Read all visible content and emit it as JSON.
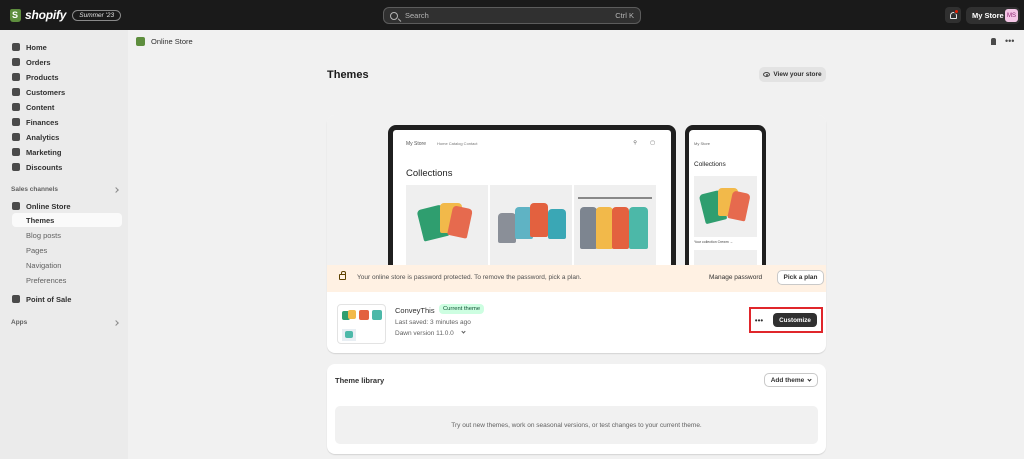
{
  "topbar": {
    "brand": "shopify",
    "edition": "Summer '23",
    "search_placeholder": "Search",
    "search_shortcut": "Ctrl K",
    "store_name": "My Store",
    "avatar_initials": "MS"
  },
  "sidebar": {
    "items": [
      {
        "label": "Home",
        "icon": "home-icon"
      },
      {
        "label": "Orders",
        "icon": "orders-icon"
      },
      {
        "label": "Products",
        "icon": "tag-icon"
      },
      {
        "label": "Customers",
        "icon": "person-icon"
      },
      {
        "label": "Content",
        "icon": "content-icon"
      },
      {
        "label": "Finances",
        "icon": "bank-icon"
      },
      {
        "label": "Analytics",
        "icon": "bar-chart-icon"
      },
      {
        "label": "Marketing",
        "icon": "target-icon"
      },
      {
        "label": "Discounts",
        "icon": "discount-icon"
      }
    ],
    "sales_channels_label": "Sales channels",
    "online_store": "Online Store",
    "online_store_subitems": [
      "Themes",
      "Blog posts",
      "Pages",
      "Navigation",
      "Preferences"
    ],
    "point_of_sale": "Point of Sale",
    "apps_label": "Apps"
  },
  "header": {
    "breadcrumb": "Online Store"
  },
  "main": {
    "title": "Themes",
    "view_store": "View your store",
    "preview": {
      "store_name": "My Store",
      "nav_links": "Home   Catalog   Contact",
      "collections_title": "Collections",
      "phone_caption": "Your collection Crewm →"
    },
    "banner": {
      "text": "Your online store is password protected. To remove the password, pick a plan.",
      "manage_password": "Manage password",
      "pick_plan": "Pick a plan"
    },
    "current_theme": {
      "name": "ConveyThis",
      "badge": "Current theme",
      "last_saved": "Last saved: 3 minutes ago",
      "version": "Dawn version 11.0.0",
      "more_label": "•••",
      "customize": "Customize"
    },
    "library": {
      "title": "Theme library",
      "add_theme": "Add theme",
      "empty_text": "Try out new themes, work on seasonal versions, or test changes to your current theme."
    }
  },
  "colors": {
    "topbar_bg": "#1a1a1a",
    "brand_green": "#5e8e3e",
    "primary_button": "#303030",
    "badge_bg": "#cdfee1",
    "banner_bg": "#fff1e3",
    "highlight_box": "#e0262b"
  }
}
